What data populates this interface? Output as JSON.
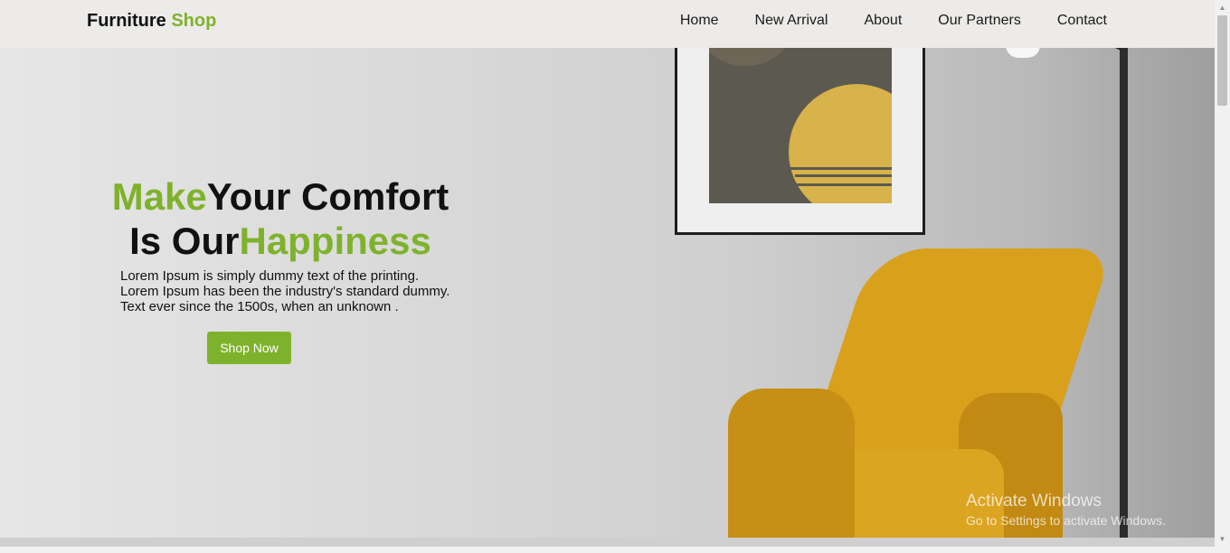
{
  "brand": {
    "name": "Furniture",
    "accent": "Shop"
  },
  "nav": {
    "items": [
      {
        "label": "Home"
      },
      {
        "label": "New Arrival"
      },
      {
        "label": "About"
      },
      {
        "label": "Our Partners"
      },
      {
        "label": "Contact"
      }
    ]
  },
  "hero": {
    "headline": {
      "line1_accent": "Make",
      "line1_rest": "Your Comfort",
      "line2_start": "Is Our",
      "line2_accent": "Happiness"
    },
    "description": [
      "Lorem Ipsum is simply dummy text of the printing.",
      "Lorem Ipsum has been the industry's standard dummy.",
      "Text ever since the 1500s, when an unknown ."
    ],
    "cta_label": "Shop Now"
  },
  "watermark": {
    "title": "Activate Windows",
    "subtitle": "Go to Settings to activate Windows."
  },
  "colors": {
    "accent": "#7fb22c",
    "navbar_bg": "#ecebe9",
    "text": "#111111",
    "chair": "#d9a01c"
  },
  "icons": {
    "scroll_up": "chevron-up-icon",
    "scroll_down": "chevron-down-icon"
  }
}
